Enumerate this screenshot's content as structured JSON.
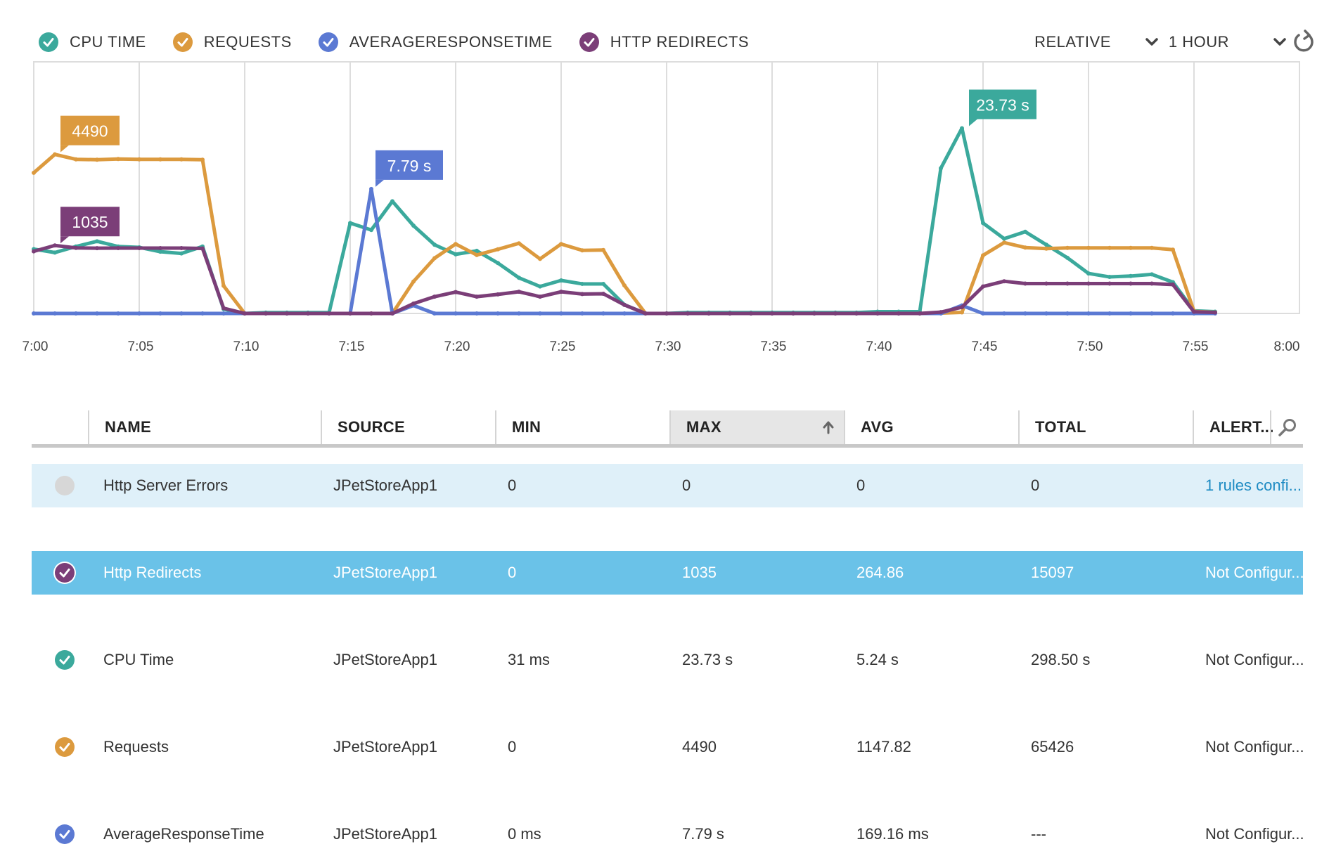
{
  "legend": [
    {
      "label": "CPU TIME",
      "color": "#3ba99c",
      "icon": "check-circle-icon"
    },
    {
      "label": "REQUESTS",
      "color": "#dc9a3e",
      "icon": "check-circle-icon"
    },
    {
      "label": "AVERAGERESPONSETIME",
      "color": "#5b79d3",
      "icon": "check-circle-icon"
    },
    {
      "label": "HTTP REDIRECTS",
      "color": "#7b3e78",
      "icon": "check-circle-icon"
    }
  ],
  "controls": {
    "mode_label": "RELATIVE",
    "range_label": "1 HOUR",
    "mode_icon": "chevron-down-icon",
    "range_icon": "chevron-down-icon",
    "refresh_icon": "refresh-icon"
  },
  "chart_data": {
    "type": "line",
    "x_ticks": [
      "7:00",
      "7:05",
      "7:10",
      "7:15",
      "7:20",
      "7:25",
      "7:30",
      "7:35",
      "7:40",
      "7:45",
      "7:50",
      "7:55",
      "8:00"
    ],
    "xlim": [
      "7:00",
      "8:00"
    ],
    "x": [
      "7:00",
      "7:01",
      "7:02",
      "7:03",
      "7:04",
      "7:05",
      "7:06",
      "7:07",
      "7:08",
      "7:09",
      "7:10",
      "7:11",
      "7:12",
      "7:13",
      "7:14",
      "7:15",
      "7:16",
      "7:17",
      "7:18",
      "7:19",
      "7:20",
      "7:21",
      "7:22",
      "7:23",
      "7:24",
      "7:25",
      "7:26",
      "7:27",
      "7:28",
      "7:29",
      "7:30",
      "7:31",
      "7:32",
      "7:33",
      "7:34",
      "7:35",
      "7:36",
      "7:37",
      "7:38",
      "7:39",
      "7:40",
      "7:41",
      "7:42",
      "7:43",
      "7:44",
      "7:45",
      "7:46",
      "7:47",
      "7:48",
      "7:49",
      "7:50",
      "7:51",
      "7:52",
      "7:53",
      "7:54",
      "7:55",
      "7:56"
    ],
    "grid": true,
    "series": [
      {
        "name": "CPU TIME",
        "unit": "s",
        "color": "#3ba99c",
        "max": 23.73,
        "values": [
          7.4,
          7.0,
          7.7,
          8.3,
          7.7,
          7.6,
          7.1,
          6.9,
          7.7,
          0.5,
          0,
          0.1,
          0.1,
          0.1,
          0.1,
          10.4,
          9.6,
          12.9,
          10.1,
          7.9,
          6.8,
          7.2,
          5.8,
          4.1,
          3.1,
          3.8,
          3.4,
          3.4,
          1.0,
          0,
          0,
          0.1,
          0.1,
          0.1,
          0.1,
          0.1,
          0.1,
          0.1,
          0.1,
          0.1,
          0.2,
          0.2,
          0.2,
          16.7,
          21.3,
          10.4,
          8.6,
          9.4,
          7.9,
          6.4,
          4.6,
          4.2,
          4.3,
          4.5,
          3.6,
          0.3,
          0.2
        ]
      },
      {
        "name": "REQUESTS",
        "unit": "",
        "color": "#dc9a3e",
        "max": 4490,
        "values": [
          3970,
          4490,
          4350,
          4340,
          4360,
          4350,
          4350,
          4350,
          4340,
          780,
          0,
          0,
          0,
          0,
          0,
          0,
          0,
          0,
          900,
          1560,
          1960,
          1650,
          1810,
          1980,
          1540,
          1960,
          1780,
          1790,
          790,
          0,
          0,
          0,
          0,
          0,
          0,
          0,
          0,
          0,
          0,
          0,
          0,
          0,
          0,
          10,
          30,
          1640,
          2000,
          1860,
          1830,
          1850,
          1850,
          1850,
          1850,
          1850,
          1800,
          60,
          30
        ]
      },
      {
        "name": "AVERAGERESPONSETIME",
        "unit": "s",
        "color": "#5b79d3",
        "max": 7.79,
        "values": [
          0,
          0,
          0,
          0,
          0,
          0,
          0,
          0,
          0,
          0,
          0,
          0,
          0,
          0,
          0,
          0,
          7.79,
          0,
          0.5,
          0,
          0,
          0,
          0,
          0,
          0,
          0,
          0,
          0,
          0,
          0,
          0,
          0,
          0,
          0,
          0,
          0,
          0,
          0,
          0,
          0,
          0,
          0,
          0,
          0,
          0.5,
          0,
          0,
          0,
          0,
          0,
          0,
          0,
          0,
          0,
          0,
          0,
          0
        ]
      },
      {
        "name": "HTTP REDIRECTS",
        "unit": "",
        "color": "#7b3e78",
        "max": 1035,
        "values": [
          945,
          1035,
          997,
          993,
          995,
          995,
          995,
          995,
          990,
          80,
          0,
          0,
          0,
          0,
          0,
          0,
          0,
          0,
          150,
          255,
          325,
          255,
          290,
          330,
          255,
          330,
          295,
          300,
          130,
          0,
          0,
          0,
          0,
          0,
          0,
          0,
          0,
          0,
          0,
          0,
          0,
          0,
          0,
          20,
          95,
          410,
          490,
          455,
          455,
          455,
          455,
          455,
          455,
          455,
          440,
          25,
          15
        ]
      }
    ],
    "callouts": [
      {
        "series": "REQUESTS",
        "text": "4490"
      },
      {
        "series": "HTTP REDIRECTS",
        "text": "1035"
      },
      {
        "series": "AVERAGERESPONSETIME",
        "text": "7.79 s"
      },
      {
        "series": "CPU TIME",
        "text": "23.73 s"
      }
    ]
  },
  "table": {
    "headers": {
      "name": "NAME",
      "source": "SOURCE",
      "min": "MIN",
      "max": "MAX",
      "avg": "AVG",
      "total": "TOTAL",
      "alerts": "ALERT..."
    },
    "sort_icon": "arrow-up-icon",
    "search_icon": "search-icon",
    "rows": [
      {
        "check_color": "#d7d7d7",
        "name": "Http Server Errors",
        "source": "JPetStoreApp1",
        "min": "0",
        "max": "0",
        "avg": "0",
        "total": "0",
        "alerts": "1 rules confi...",
        "alerts_link": true,
        "state": "hover",
        "checked": false
      },
      {
        "check_color": "#7b3e78",
        "name": "Http Redirects",
        "source": "JPetStoreApp1",
        "min": "0",
        "max": "1035",
        "avg": "264.86",
        "total": "15097",
        "alerts": "Not Configur...",
        "alerts_link": false,
        "state": "selected",
        "checked": true
      },
      {
        "check_color": "#3ba99c",
        "name": "CPU Time",
        "source": "JPetStoreApp1",
        "min": "31 ms",
        "max": "23.73 s",
        "avg": "5.24 s",
        "total": "298.50 s",
        "alerts": "Not Configur...",
        "alerts_link": false,
        "state": "",
        "checked": true
      },
      {
        "check_color": "#dc9a3e",
        "name": "Requests",
        "source": "JPetStoreApp1",
        "min": "0",
        "max": "4490",
        "avg": "1147.82",
        "total": "65426",
        "alerts": "Not Configur...",
        "alerts_link": false,
        "state": "",
        "checked": true
      },
      {
        "check_color": "#5b79d3",
        "name": "AverageResponseTime",
        "source": "JPetStoreApp1",
        "min": "0 ms",
        "max": "7.79 s",
        "avg": "169.16 ms",
        "total": "---",
        "alerts": "Not Configur...",
        "alerts_link": false,
        "state": "",
        "checked": true
      }
    ]
  }
}
